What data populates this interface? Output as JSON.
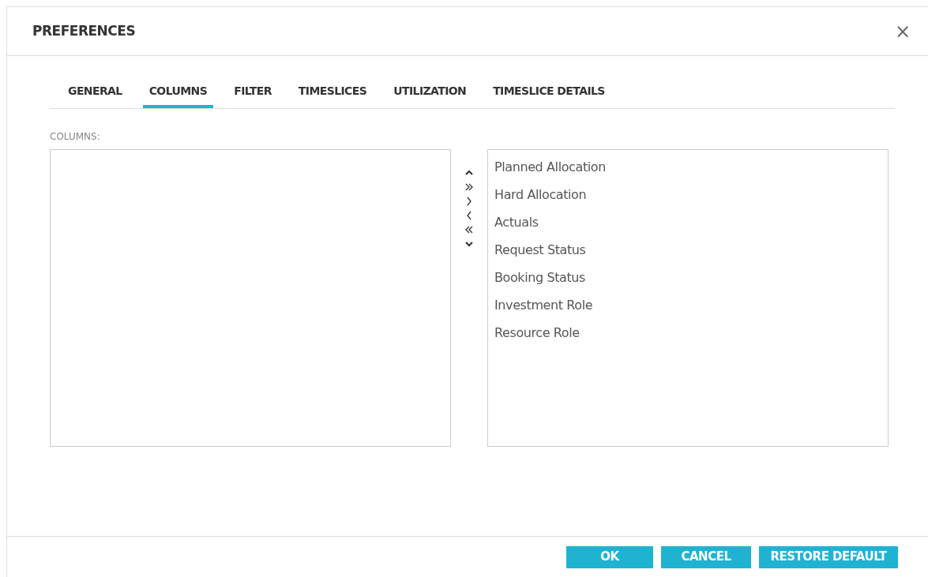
{
  "dialog": {
    "title": "PREFERENCES",
    "close": "×"
  },
  "tabs": [
    {
      "label": "GENERAL",
      "selected": false
    },
    {
      "label": "COLUMNS",
      "selected": true
    },
    {
      "label": "FILTER",
      "selected": false
    },
    {
      "label": "TIMESLICES",
      "selected": false
    },
    {
      "label": "UTILIZATION",
      "selected": false
    },
    {
      "label": "TIMESLICE DETAILS",
      "selected": false
    }
  ],
  "columns_label": "COLUMNS:",
  "movers": [
    {
      "kind": "up"
    },
    {
      "kind": "add_all"
    },
    {
      "kind": "add"
    },
    {
      "kind": "remove"
    },
    {
      "kind": "remove_all"
    },
    {
      "kind": "down"
    }
  ],
  "selected_columns": [
    "Planned Allocation",
    "Hard Allocation",
    "Actuals",
    "Request Status",
    "Booking Status",
    "Investment Role",
    "Resource Role"
  ],
  "buttons": [
    "OK",
    "CANCEL",
    "RESTORE DEFAULT"
  ]
}
